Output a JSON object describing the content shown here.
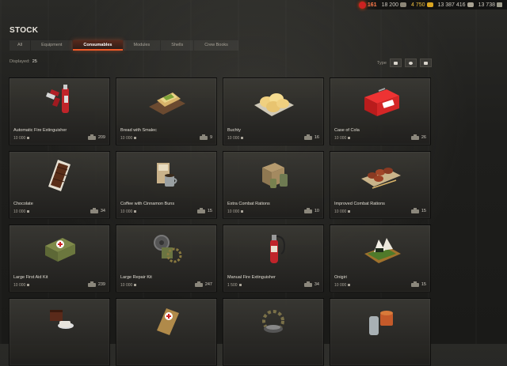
{
  "currency": {
    "premium": "161",
    "bonds": "18 200",
    "gold": "4 750",
    "credits": "13 387 416",
    "free_xp": "13 738"
  },
  "page_title": "STOCK",
  "tabs": [
    {
      "label": "All",
      "active": false
    },
    {
      "label": "Equipment",
      "active": false
    },
    {
      "label": "Consumables",
      "active": true
    },
    {
      "label": "Modules",
      "active": false
    },
    {
      "label": "Shells",
      "active": false
    },
    {
      "label": "Crew Books",
      "active": false
    }
  ],
  "displayed": {
    "label": "Displayed:",
    "value": "25"
  },
  "type_filter": {
    "label": "Type"
  },
  "items": [
    {
      "name": "Automatic Fire Extinguisher",
      "price": "10 000",
      "count": "209",
      "icon": "fire-extinguisher-auto-icon"
    },
    {
      "name": "Bread with Smalec",
      "price": "10 000",
      "count": "9",
      "icon": "bread-icon"
    },
    {
      "name": "Buchty",
      "price": "10 000",
      "count": "16",
      "icon": "buchty-icon"
    },
    {
      "name": "Case of Cola",
      "price": "10 000",
      "count": "26",
      "icon": "cola-case-icon"
    },
    {
      "name": "Chocolate",
      "price": "10 000",
      "count": "34",
      "icon": "chocolate-icon"
    },
    {
      "name": "Coffee with Cinnamon Buns",
      "price": "10 000",
      "count": "15",
      "icon": "coffee-icon"
    },
    {
      "name": "Extra Combat Rations",
      "price": "10 000",
      "count": "10",
      "icon": "rations-icon"
    },
    {
      "name": "Improved Combat Rations",
      "price": "10 000",
      "count": "15",
      "icon": "improved-rations-icon"
    },
    {
      "name": "Large First Aid Kit",
      "price": "10 000",
      "count": "239",
      "icon": "first-aid-kit-icon"
    },
    {
      "name": "Large Repair Kit",
      "price": "10 000",
      "count": "247",
      "icon": "repair-kit-icon"
    },
    {
      "name": "Manual Fire Extinguisher",
      "price": "1 500",
      "count": "34",
      "icon": "fire-extinguisher-manual-icon"
    },
    {
      "name": "Onigiri",
      "price": "10 000",
      "count": "15",
      "icon": "onigiri-icon"
    },
    {
      "name": "",
      "price": "",
      "count": "",
      "icon": "cake-tea-icon"
    },
    {
      "name": "",
      "price": "",
      "count": "",
      "icon": "small-first-aid-icon"
    },
    {
      "name": "",
      "price": "",
      "count": "",
      "icon": "small-repair-kit-icon"
    },
    {
      "name": "",
      "price": "",
      "count": "",
      "icon": "canned-food-icon"
    }
  ]
}
